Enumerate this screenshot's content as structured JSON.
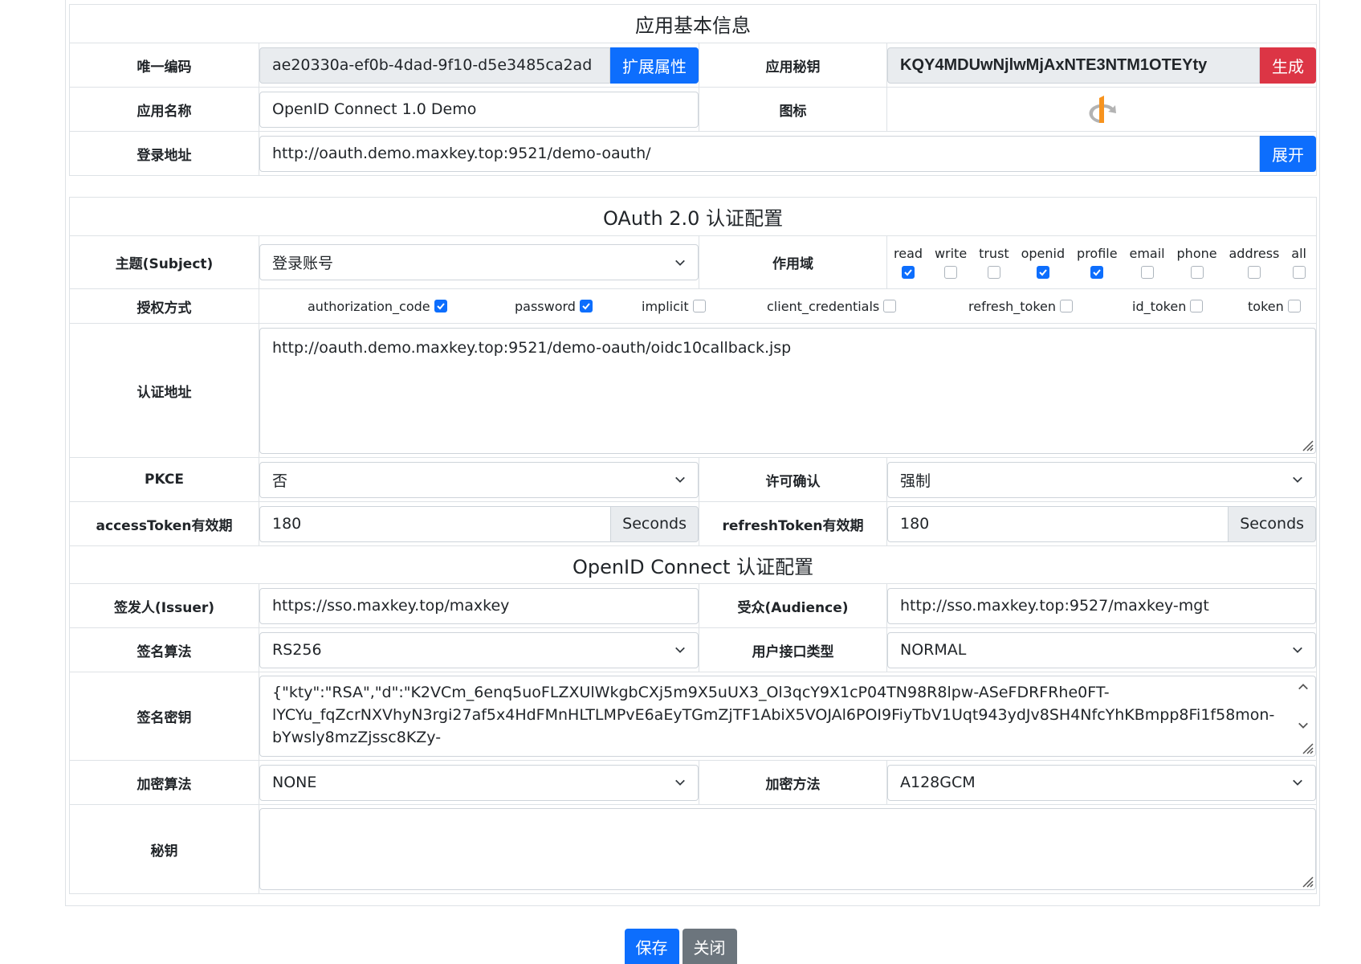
{
  "basic": {
    "section_title": "应用基本信息",
    "unique_code": {
      "label": "唯一编码",
      "value": "ae20330a-ef0b-4dad-9f10-d5e3485ca2ad",
      "button": "扩展属性"
    },
    "app_secret": {
      "label": "应用秘钥",
      "value": "KQY4MDUwNjlwMjAxNTE3NTM1OTEYty",
      "button": "生成"
    },
    "app_name": {
      "label": "应用名称",
      "value": "OpenID Connect 1.0  Demo"
    },
    "icon": {
      "label": "图标",
      "icon_name": "openid-logo-icon"
    },
    "login_url": {
      "label": "登录地址",
      "value": "http://oauth.demo.maxkey.top:9521/demo-oauth/",
      "button": "展开"
    }
  },
  "oauth": {
    "section_title": "OAuth 2.0 认证配置",
    "subject": {
      "label": "主题(Subject)",
      "value": "登录账号"
    },
    "scope": {
      "label": "作用域",
      "items": [
        {
          "name": "read",
          "checked": true
        },
        {
          "name": "write",
          "checked": false
        },
        {
          "name": "trust",
          "checked": false
        },
        {
          "name": "openid",
          "checked": true
        },
        {
          "name": "profile",
          "checked": true
        },
        {
          "name": "email",
          "checked": false
        },
        {
          "name": "phone",
          "checked": false
        },
        {
          "name": "address",
          "checked": false
        },
        {
          "name": "all",
          "checked": false
        }
      ]
    },
    "grant_types": {
      "label": "授权方式",
      "items": [
        {
          "name": "authorization_code",
          "checked": true
        },
        {
          "name": "password",
          "checked": true
        },
        {
          "name": "implicit",
          "checked": false
        },
        {
          "name": "client_credentials",
          "checked": false
        },
        {
          "name": "refresh_token",
          "checked": false
        },
        {
          "name": "id_token",
          "checked": false
        },
        {
          "name": "token",
          "checked": false
        }
      ]
    },
    "redirect_uri": {
      "label": "认证地址",
      "value": "http://oauth.demo.maxkey.top:9521/demo-oauth/oidc10callback.jsp"
    },
    "pkce": {
      "label": "PKCE",
      "value": "否"
    },
    "approval": {
      "label": "许可确认",
      "value": "强制"
    },
    "access_token": {
      "label": "accessToken有效期",
      "value": "180",
      "unit": "Seconds"
    },
    "refresh_token": {
      "label": "refreshToken有效期",
      "value": "180",
      "unit": "Seconds"
    }
  },
  "oidc": {
    "section_title": "OpenID Connect 认证配置",
    "issuer": {
      "label": "签发人(Issuer)",
      "value": "https://sso.maxkey.top/maxkey"
    },
    "audience": {
      "label": "受众(Audience)",
      "value": "http://sso.maxkey.top:9527/maxkey-mgt"
    },
    "sign_alg": {
      "label": "签名算法",
      "value": "RS256"
    },
    "userinfo_type": {
      "label": "用户接口类型",
      "value": "NORMAL"
    },
    "sign_key": {
      "label": "签名密钥",
      "line1": "{\"kty\":\"RSA\",\"d\":\"K2VCm_6enq5uoFLZXUlWkgbCXj5m9X5uUX3_Ol3qcY9X1cP04TN98R8lpw-ASeFDRFRhe0FT-",
      "line2": "lYCYu_fqZcrNXVhyN3rgi27af5x4HdFMnHLTLMPvE6aEyTGmZjTF1AbiX5VOJAl6POI9FiyTbV1Uqt943ydJv8SH4NfcYhKBmpp8Fi1f58mon-",
      "line3": "bYwsly8mzZjssc8KZy-"
    },
    "enc_alg": {
      "label": "加密算法",
      "value": "NONE"
    },
    "enc_method": {
      "label": "加密方法",
      "value": "A128GCM"
    },
    "secret": {
      "label": "秘钥",
      "value": ""
    }
  },
  "actions": {
    "save": "保存",
    "close": "关闭"
  },
  "colors": {
    "primary": "#0d6efd",
    "danger": "#dc3545",
    "secondary": "#6c757d"
  }
}
